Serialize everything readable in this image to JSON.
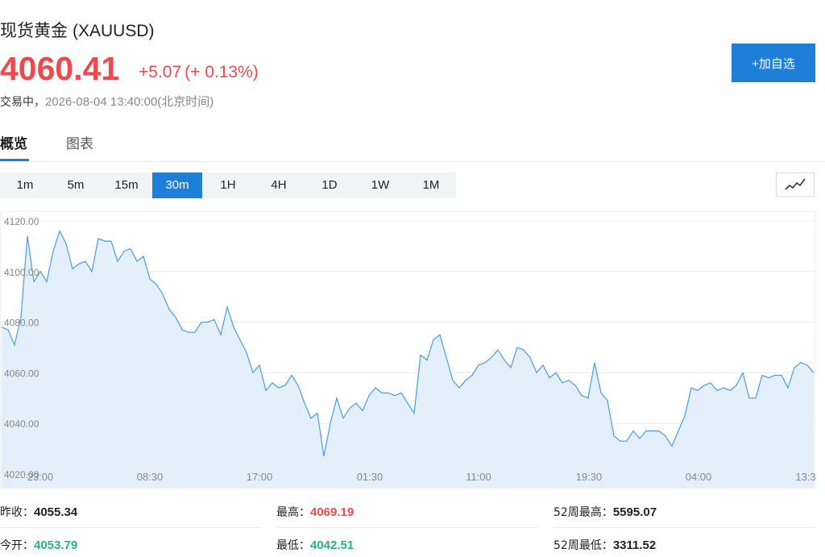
{
  "header": {
    "name": "现货黄金",
    "code": "(XAUUSD)",
    "price": "4060.41",
    "change": "+5.07",
    "change_pct": "(+ 0.13%)",
    "status": "交易中，",
    "datetime": "2026-08-04 13:40:00",
    "timezone": "(北京时间)",
    "add_button": "+加自选"
  },
  "tabs": [
    {
      "label": "概览",
      "active": true
    },
    {
      "label": "图表",
      "active": false
    }
  ],
  "intervals": [
    {
      "label": "1m"
    },
    {
      "label": "5m"
    },
    {
      "label": "15m"
    },
    {
      "label": "30m",
      "active": true
    },
    {
      "label": "1H"
    },
    {
      "label": "4H"
    },
    {
      "label": "1D"
    },
    {
      "label": "1W"
    },
    {
      "label": "1M"
    }
  ],
  "chart_data": {
    "type": "area",
    "x_tick_labels": [
      "23:00",
      "08:30",
      "17:00",
      "01:30",
      "11:00",
      "19:30",
      "04:00",
      "13:3"
    ],
    "y_tick_labels": [
      "4120.00",
      "4100.00",
      "4080.00",
      "4060.00",
      "4040.00",
      "4020.00"
    ],
    "ylim": [
      4020,
      4120
    ],
    "grid": true,
    "line_color": "#4a9be8",
    "fill_color": "#e3f0fc",
    "values": [
      4078,
      4077,
      4071,
      4082,
      4114,
      4096,
      4100,
      4096,
      4108,
      4116,
      4111,
      4101,
      4103,
      4104,
      4100,
      4113,
      4112,
      4112,
      4104,
      4108,
      4109,
      4104,
      4106,
      4097,
      4095,
      4091,
      4085,
      4082,
      4077,
      4076,
      4076,
      4080,
      4080,
      4081,
      4075,
      4086,
      4078,
      4073,
      4068,
      4060,
      4063,
      4053,
      4056,
      4054,
      4055,
      4059,
      4055,
      4048,
      4042,
      4044,
      4027,
      4040,
      4050,
      4042,
      4046,
      4048,
      4045,
      4051,
      4054,
      4052,
      4052,
      4051,
      4052,
      4048,
      4044,
      4067,
      4065,
      4073,
      4075,
      4066,
      4057,
      4054,
      4057,
      4059,
      4063,
      4064,
      4066,
      4069,
      4065,
      4062,
      4070,
      4069,
      4066,
      4060,
      4063,
      4058,
      4060,
      4056,
      4057,
      4055,
      4051,
      4050,
      4064,
      4052,
      4049,
      4035,
      4033,
      4033,
      4037,
      4034,
      4037,
      4037,
      4037,
      4035,
      4031,
      4037,
      4043,
      4054,
      4053,
      4055,
      4056,
      4053,
      4054,
      4053,
      4055,
      4060,
      4050,
      4050,
      4059,
      4058,
      4059,
      4059,
      4054,
      4062,
      4064,
      4063,
      4060
    ]
  },
  "stats": [
    {
      "label": "昨收：",
      "value": "4055.34",
      "color": "dark"
    },
    {
      "label": "最高：",
      "value": "4069.19",
      "color": "red"
    },
    {
      "label": "52周最高：",
      "value": "5595.07",
      "color": "dark"
    },
    {
      "label": "今开：",
      "value": "4053.79",
      "color": "green"
    },
    {
      "label": "最低：",
      "value": "4042.51",
      "color": "green"
    },
    {
      "label": "52周最低：",
      "value": "3311.52",
      "color": "dark"
    }
  ]
}
